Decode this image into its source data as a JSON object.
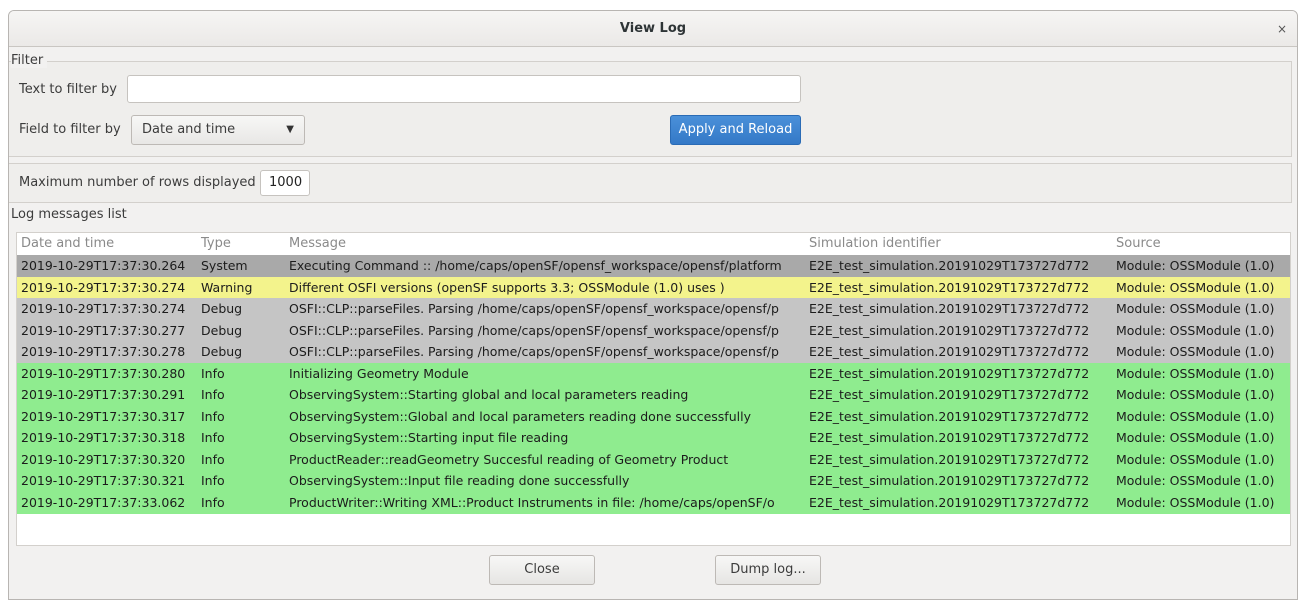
{
  "window": {
    "title": "View Log",
    "close_glyph": "×"
  },
  "filter": {
    "legend": "Filter",
    "text_label": "Text to filter by",
    "text_value": "",
    "field_label": "Field to filter by",
    "field_selected": "Date and time",
    "apply_label": "Apply and Reload"
  },
  "rows_limit": {
    "label": "Maximum number of rows displayed",
    "value": "1000"
  },
  "log": {
    "legend": "Log messages list",
    "columns": [
      "Date and time",
      "Type",
      "Message",
      "Simulation identifier",
      "Source"
    ],
    "rows": [
      {
        "level": "system",
        "date": "2019-10-29T17:37:30.264",
        "type": "System",
        "message": "Executing Command :: /home/caps/openSF/opensf_workspace/opensf/platform",
        "sim": "E2E_test_simulation.20191029T173727d772",
        "source": "Module: OSSModule (1.0)"
      },
      {
        "level": "warning",
        "date": "2019-10-29T17:37:30.274",
        "type": "Warning",
        "message": "Different OSFI versions (openSF supports 3.3; OSSModule (1.0) uses )",
        "sim": "E2E_test_simulation.20191029T173727d772",
        "source": "Module: OSSModule (1.0)"
      },
      {
        "level": "debug",
        "date": "2019-10-29T17:37:30.274",
        "type": "Debug",
        "message": "OSFI::CLP::parseFiles. Parsing /home/caps/openSF/opensf_workspace/opensf/p",
        "sim": "E2E_test_simulation.20191029T173727d772",
        "source": "Module: OSSModule (1.0)"
      },
      {
        "level": "debug",
        "date": "2019-10-29T17:37:30.277",
        "type": "Debug",
        "message": "OSFI::CLP::parseFiles. Parsing /home/caps/openSF/opensf_workspace/opensf/p",
        "sim": "E2E_test_simulation.20191029T173727d772",
        "source": "Module: OSSModule (1.0)"
      },
      {
        "level": "debug",
        "date": "2019-10-29T17:37:30.278",
        "type": "Debug",
        "message": "OSFI::CLP::parseFiles. Parsing /home/caps/openSF/opensf_workspace/opensf/p",
        "sim": "E2E_test_simulation.20191029T173727d772",
        "source": "Module: OSSModule (1.0)"
      },
      {
        "level": "info",
        "date": "2019-10-29T17:37:30.280",
        "type": "Info",
        "message": "Initializing Geometry Module",
        "sim": "E2E_test_simulation.20191029T173727d772",
        "source": "Module: OSSModule (1.0)"
      },
      {
        "level": "info",
        "date": "2019-10-29T17:37:30.291",
        "type": "Info",
        "message": "ObservingSystem::Starting global and local parameters reading",
        "sim": "E2E_test_simulation.20191029T173727d772",
        "source": "Module: OSSModule (1.0)"
      },
      {
        "level": "info",
        "date": "2019-10-29T17:37:30.317",
        "type": "Info",
        "message": "ObservingSystem::Global and local parameters reading done successfully",
        "sim": "E2E_test_simulation.20191029T173727d772",
        "source": "Module: OSSModule (1.0)"
      },
      {
        "level": "info",
        "date": "2019-10-29T17:37:30.318",
        "type": "Info",
        "message": "ObservingSystem::Starting input file reading",
        "sim": "E2E_test_simulation.20191029T173727d772",
        "source": "Module: OSSModule (1.0)"
      },
      {
        "level": "info",
        "date": "2019-10-29T17:37:30.320",
        "type": "Info",
        "message": "ProductReader::readGeometry Succesful reading of Geometry Product",
        "sim": "E2E_test_simulation.20191029T173727d772",
        "source": "Module: OSSModule (1.0)"
      },
      {
        "level": "info",
        "date": "2019-10-29T17:37:30.321",
        "type": "Info",
        "message": "ObservingSystem::Input file reading done successfully",
        "sim": "E2E_test_simulation.20191029T173727d772",
        "source": "Module: OSSModule (1.0)"
      },
      {
        "level": "info",
        "date": "2019-10-29T17:37:33.062",
        "type": "Info",
        "message": "ProductWriter::Writing XML::Product Instruments in file: /home/caps/openSF/o",
        "sim": "E2E_test_simulation.20191029T173727d772",
        "source": "Module: OSSModule (1.0)"
      }
    ]
  },
  "footer": {
    "close_label": "Close",
    "dump_label": "Dump log..."
  },
  "colors": {
    "system": "#a9a9a9",
    "warning": "#f3f38c",
    "debug": "#c5c5c5",
    "info": "#8fec8f",
    "accent": "#3b82d0"
  }
}
